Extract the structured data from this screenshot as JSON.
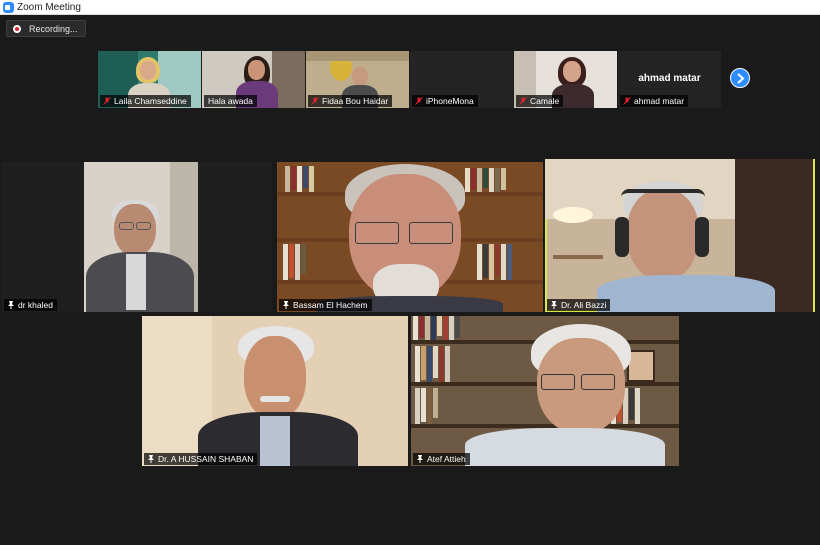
{
  "window": {
    "title": "Zoom Meeting"
  },
  "recording": {
    "label": "Recording..."
  },
  "gallery_strip": [
    {
      "name": "Laila Chamseddine",
      "muted": true
    },
    {
      "name": "Hala awada",
      "muted": false
    },
    {
      "name": "Fidaa Bou Haidar",
      "muted": true
    },
    {
      "name": "iPhoneMona",
      "muted": true
    },
    {
      "name": "Camale",
      "muted": true
    },
    {
      "name": "ahmad matar",
      "muted": true,
      "display_name": "ahmad matar"
    }
  ],
  "main_grid": [
    {
      "name": "dr khaled",
      "muted": false
    },
    {
      "name": "Bassam El Hachem",
      "muted": false
    },
    {
      "name": "Dr. Ali Bazzi",
      "muted": false,
      "active_speaker": true
    },
    {
      "name": "Dr. A HUSSAIN SHABAN",
      "muted": false
    },
    {
      "name": "Atef Attieh",
      "muted": false
    }
  ],
  "icons": {
    "next_page": "chevron-right-icon",
    "muted": "mic-muted-icon",
    "pinned": "pin-icon",
    "recording": "recording-dot-icon",
    "app": "zoom-logo-icon"
  },
  "colors": {
    "stage_bg": "#1a1a1a",
    "active_speaker_border": "#d9e84a",
    "accent": "#2d8cff",
    "muted_icon": "#e0242e"
  }
}
